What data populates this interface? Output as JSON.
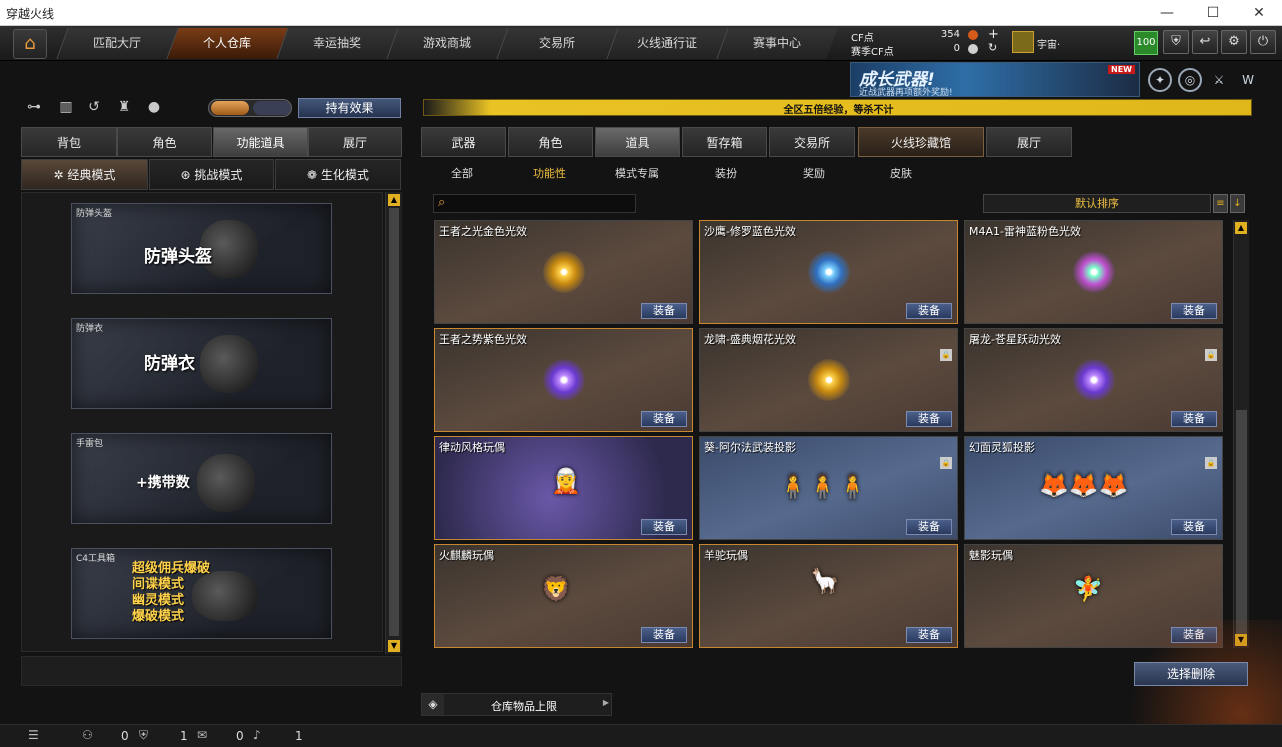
{
  "window": {
    "title": "穿越火线",
    "minimize": "—",
    "maximize": "☐",
    "close": "✕"
  },
  "nav": {
    "tabs": [
      "匹配大厅",
      "个人仓库",
      "幸运抽奖",
      "游戏商城",
      "交易所",
      "火线通行证",
      "赛事中心"
    ],
    "active": 1
  },
  "currency": {
    "cf_label": "CF点",
    "cf_value": "354",
    "season_label": "赛季CF点",
    "season_value": "0"
  },
  "user": {
    "name": "宇宙·",
    "level": "100"
  },
  "banner": {
    "title": "成长武器!",
    "subtitle": "近战武器再项额外奖励!",
    "badge": "NEW"
  },
  "left": {
    "effect_button": "持有效果",
    "tabs": [
      "背包",
      "角色",
      "功能道具",
      "展厅"
    ],
    "active_tab": 2,
    "modes": [
      "经典模式",
      "挑战模式",
      "生化模式"
    ],
    "active_mode": 0,
    "cards": [
      {
        "small": "防弹头盔",
        "big": "防弹头盔"
      },
      {
        "small": "防弹衣",
        "big": "防弹衣"
      },
      {
        "small": "手雷包",
        "big": "+携带数"
      },
      {
        "small": "C4工具箱",
        "lines": [
          "超级佣兵爆破",
          "间谍模式",
          "幽灵模式",
          "爆破模式"
        ]
      }
    ]
  },
  "right": {
    "notice": "全区五倍经验，等杀不计",
    "tabs": [
      "武器",
      "角色",
      "道具",
      "暂存箱",
      "交易所",
      "火线珍藏馆",
      "展厅"
    ],
    "active_tab": 2,
    "subtabs": [
      "全部",
      "功能性",
      "模式专属",
      "装扮",
      "奖励",
      "皮肤"
    ],
    "active_subtab": 1,
    "search_placeholder": "",
    "sort": "默认排序",
    "equip": "装备",
    "items": [
      {
        "name": "王者之光金色光效",
        "style": "brown",
        "orb": "gold",
        "lock": false
      },
      {
        "name": "沙鹰-修罗蓝色光效",
        "style": "brown",
        "orb": "blue",
        "lock": false
      },
      {
        "name": "M4A1-雷神蓝粉色光效",
        "style": "brown",
        "orb": "rainbow",
        "lock": false
      },
      {
        "name": "王者之势紫色光效",
        "style": "brown",
        "orb": "purple",
        "lock": false
      },
      {
        "name": "龙啸-盛典烟花光效",
        "style": "brown",
        "orb": "gold",
        "lock": true
      },
      {
        "name": "屠龙-苍星跃动光效",
        "style": "brown",
        "orb": "purple",
        "lock": true
      },
      {
        "name": "律动风格玩偶",
        "style": "purple",
        "doll": "🧝",
        "lock": false
      },
      {
        "name": "葵-阿尔法武装投影",
        "style": "blue",
        "doll": "🧍🧍🧍",
        "lock": true
      },
      {
        "name": "幻面灵狐投影",
        "style": "blue",
        "doll": "🦊🦊🦊",
        "lock": true
      },
      {
        "name": "火麒麟玩偶",
        "style": "brown",
        "doll": "🦁",
        "lock": false
      },
      {
        "name": "羊驼玩偶",
        "style": "brown",
        "doll": "🦙",
        "lock": false
      },
      {
        "name": "魅影玩偶",
        "style": "brown",
        "doll": "🧚",
        "lock": false
      }
    ],
    "delete_button": "选择删除",
    "capacity": "仓库物品上限"
  },
  "status": {
    "v1": "0",
    "v2": "1",
    "v3": "0",
    "v4": "1"
  }
}
